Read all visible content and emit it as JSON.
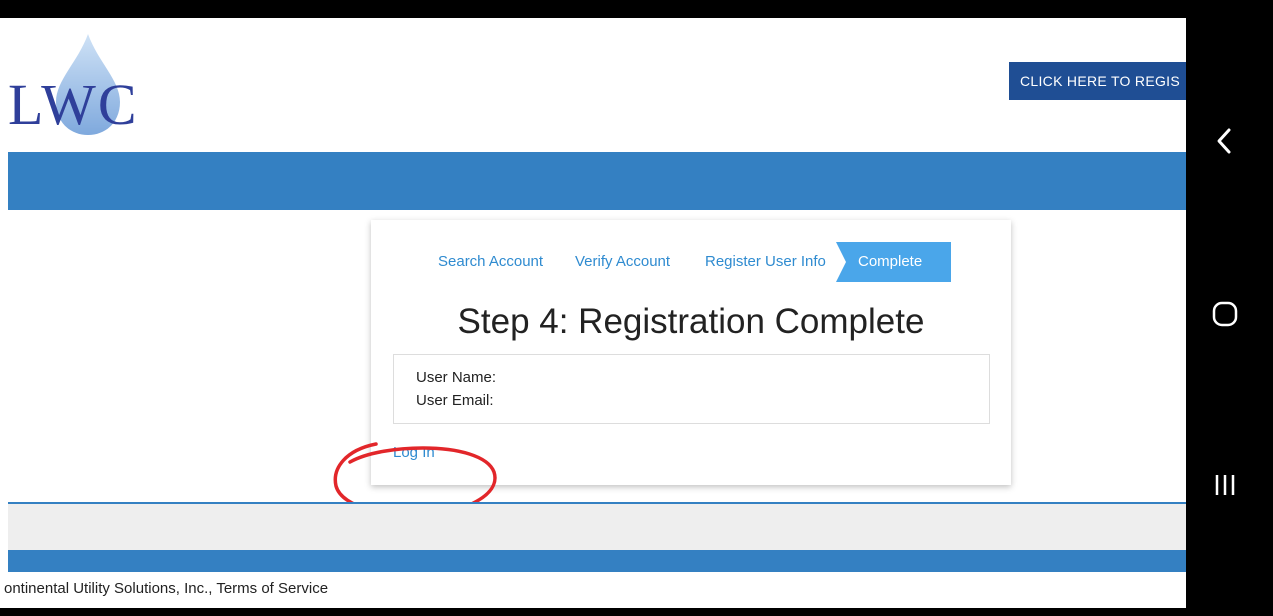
{
  "logo": {
    "text": "LWC",
    "drop_color": "#8eb8e8",
    "text_color": "#2f3f9a"
  },
  "header": {
    "register_button": "CLICK HERE TO REGIS"
  },
  "steps": {
    "items": [
      "Search Account",
      "Verify Account",
      "Register User Info"
    ],
    "active": "Complete"
  },
  "card": {
    "title": "Step 4: Registration Complete",
    "user_name_label": "User Name:",
    "user_name_value": "",
    "user_email_label": "User Email:",
    "user_email_value": "",
    "login_link": "Log In"
  },
  "footer": {
    "text": "ontinental Utility Solutions, Inc.,   Terms of Service"
  },
  "android_nav": {
    "back": "back-icon",
    "home": "home-icon",
    "recents": "recents-icon"
  },
  "colors": {
    "brand_blue": "#3480c2",
    "button_blue": "#1f4e94",
    "link_blue": "#2f8bd0",
    "annotation_red": "#e2262a"
  }
}
